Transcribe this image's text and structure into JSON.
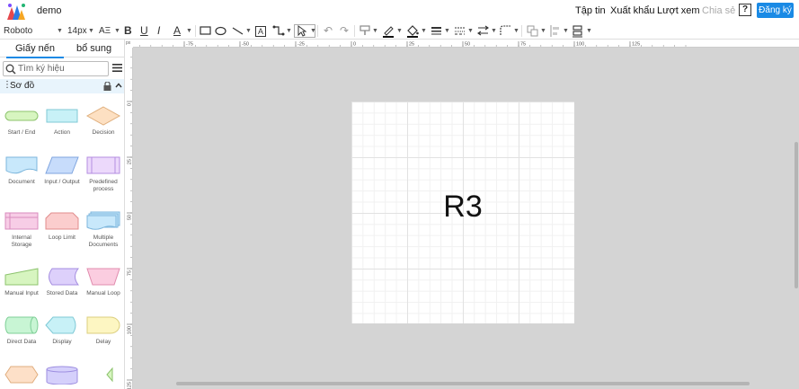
{
  "app": {
    "doc_title": "demo"
  },
  "topmenu": {
    "file": "Tập tin",
    "export": "Xuất khẩu",
    "view": "Lượt xem",
    "share": "Chia sẻ",
    "help": "?",
    "signup": "Đăng ký"
  },
  "toolbar": {
    "font": "Roboto",
    "font_size": "14px",
    "text_format": "AΞ",
    "bold": "B",
    "underline": "U",
    "italic": "I",
    "text_color": "A",
    "text_box": "A"
  },
  "panel": {
    "tabs": [
      "Giấy nến",
      "bổ sung"
    ],
    "search_placeholder": "Tìm ký hiệu",
    "section": "Sơ đồ",
    "shapes": [
      "Start / End",
      "Action",
      "Decision",
      "Document",
      "Input / Output",
      "Predefined process",
      "Internal Storage",
      "Loop Limit",
      "Multiple Documents",
      "Manual Input",
      "Stored Data",
      "Manual Loop",
      "Direct Data",
      "Display",
      "Delay"
    ]
  },
  "rulers": {
    "h_ticks": [
      "-75",
      "-50",
      "-25",
      "0",
      "25",
      "50",
      "75",
      "100",
      "125"
    ],
    "v_ticks": [
      "0",
      "25",
      "50",
      "75",
      "100",
      "125"
    ],
    "unit": "px"
  },
  "canvas": {
    "text": "R3"
  },
  "colors": {
    "accent": "#1a8ae5",
    "canvas_bg": "#d4d4d4"
  }
}
